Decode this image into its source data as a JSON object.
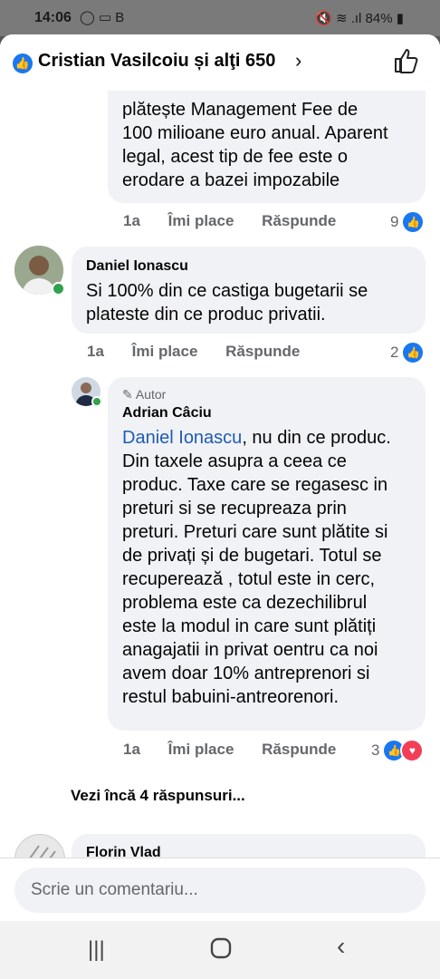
{
  "status_bar": {
    "time": "14:06",
    "left_icons": "◯ ▭ B",
    "right_icons": "🔇 ≋ .ıl",
    "battery": "84%"
  },
  "header": {
    "title": "Cristian Vasilcoiu și alţi 650"
  },
  "comments": [
    {
      "text_lines": [
        "plătește Management Fee de",
        "100 milioane euro anual. Aparent",
        "legal, acest tip de fee este o",
        "erodare a bazei impozabile"
      ],
      "time": "1a",
      "like": "Îmi place",
      "reply": "Răspunde",
      "reactions": "9"
    },
    {
      "author": "Daniel Ionascu",
      "text_lines": [
        "Si 100% din ce castiga bugetarii se",
        "plateste din ce produc privatii."
      ],
      "time": "1a",
      "like": "Îmi place",
      "reply": "Răspunde",
      "reactions": "2"
    },
    {
      "badge": "Autor",
      "author": "Adrian Câciu",
      "mention": "Daniel Ionascu",
      "first_line_rest": ", nu din ce produc.",
      "text_lines": [
        "Din taxele asupra a ceea ce",
        "produc. Taxe care se regasesc in",
        "preturi si se recupreaza prin",
        "preturi. Preturi care sunt plătite si",
        "de privați și de bugetari. Totul se",
        "recuperează , totul este in cerc,",
        "problema este ca dezechilibrul",
        "este la modul in care sunt plătiți",
        "anagajatii in privat oentru ca noi",
        "avem doar 10% antreprenori si",
        "restul babuini-antreorenori."
      ],
      "time": "1a",
      "like": "Îmi place",
      "reply": "Răspunde",
      "reactions": "3"
    }
  ],
  "more_replies": "Vezi încă 4 răspunsuri...",
  "next_author": "Florin Vlad",
  "input": {
    "placeholder": "Scrie un comentariu..."
  },
  "colors": {
    "like_blue": "#1877f2",
    "love_red": "#f33e58",
    "online_green": "#31a24c",
    "link": "#1e5bb8"
  },
  "icons": {
    "like": "thumbs-up-icon",
    "love": "heart-icon",
    "nav_recent": "recent-apps-icon",
    "nav_home": "home-icon",
    "nav_back": "back-icon"
  }
}
